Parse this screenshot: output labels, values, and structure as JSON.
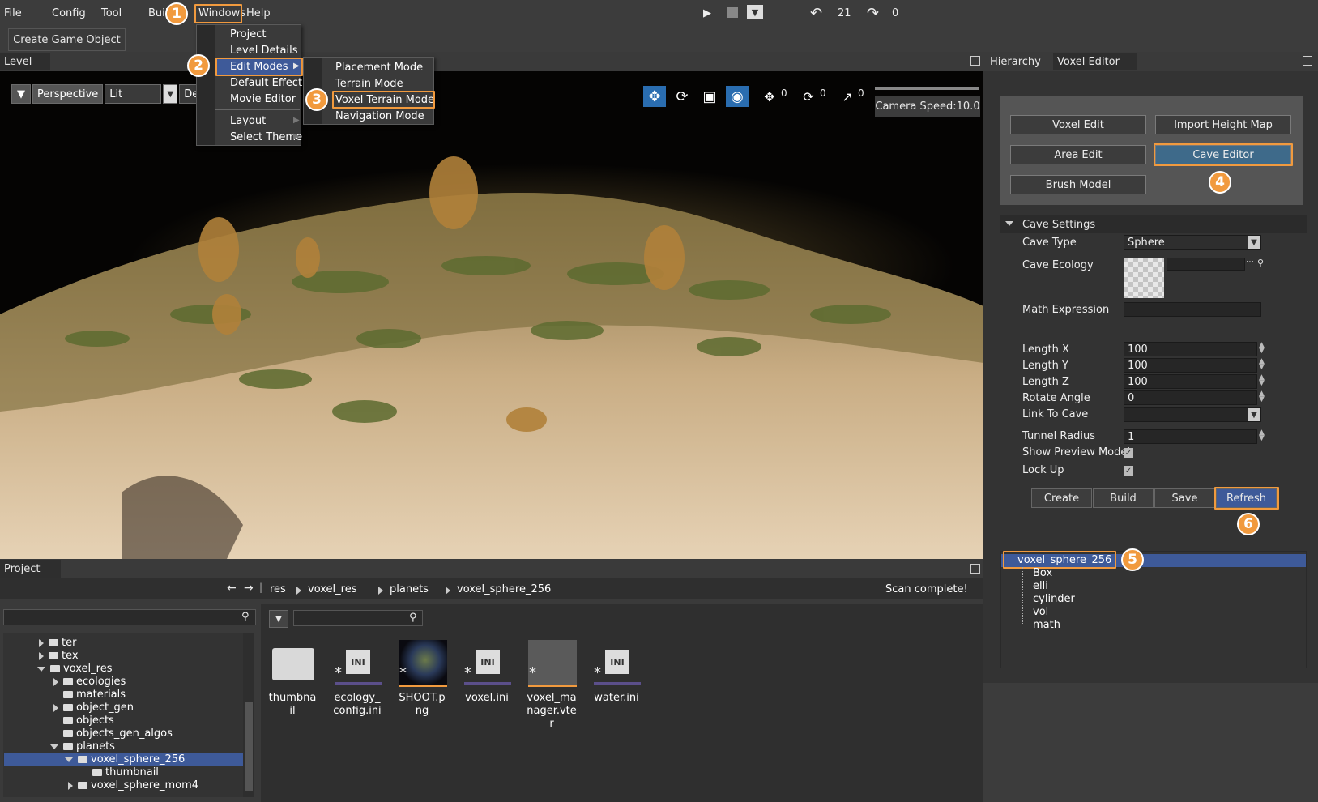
{
  "menu": [
    "File",
    "Config",
    "Tool",
    "Buil",
    "Windows",
    "Help"
  ],
  "toolbar": {
    "undo_count": "21",
    "redo_count": "0",
    "create_game_object": "Create Game Object"
  },
  "windows_menu": [
    "Project",
    "Level Details",
    "Edit Modes",
    "Default Effect",
    "Movie Editor",
    "Layout",
    "Select Theme"
  ],
  "edit_modes_menu": [
    "Placement Mode",
    "Terrain Mode",
    "Voxel Terrain Mode",
    "Navigation Mode"
  ],
  "viewport": {
    "tab": "Level",
    "perspective": "Perspective",
    "lit": "Lit",
    "default": "Defa",
    "move_count": "0",
    "rotate_count": "0",
    "scale_count": "0",
    "camera_speed": "Camera Speed:10.0"
  },
  "right_panel": {
    "tabs": [
      "Hierarchy",
      "Voxel Editor"
    ],
    "buttons": [
      "Voxel Edit",
      "Import Height Map",
      "Area Edit",
      "Cave Editor",
      "Brush Model"
    ],
    "section": "Cave Settings",
    "props": {
      "cave_type_label": "Cave Type",
      "cave_type": "Sphere",
      "cave_ecology_label": "Cave Ecology",
      "math_label": "Math Expression",
      "length_x_label": "Length X",
      "length_x": "100",
      "length_y_label": "Length Y",
      "length_y": "100",
      "length_z_label": "Length Z",
      "length_z": "100",
      "rotate_label": "Rotate Angle",
      "rotate": "0",
      "link_label": "Link To Cave",
      "tunnel_label": "Tunnel Radius",
      "tunnel": "1",
      "preview_label": "Show Preview Model",
      "lock_label": "Lock Up"
    },
    "actions": [
      "Create",
      "Build",
      "Save",
      "Refresh"
    ],
    "cave_tree": {
      "root": "voxel_sphere_256",
      "children": [
        "Box",
        "elli",
        "cylinder",
        "vol",
        "math"
      ]
    }
  },
  "project": {
    "tab": "Project",
    "breadcrumb": [
      "res",
      "voxel_res",
      "planets",
      "voxel_sphere_256"
    ],
    "status": "Scan complete!",
    "tree": [
      "ter",
      "tex",
      "voxel_res",
      "ecologies",
      "materials",
      "object_gen",
      "objects",
      "objects_gen_algos",
      "planets",
      "voxel_sphere_256",
      "thumbnail",
      "voxel_sphere_mom4"
    ],
    "files": [
      "thumbnail",
      "ecology_config.ini",
      "SHOOT.png",
      "voxel.ini",
      "voxel_manager.vter",
      "water.ini"
    ]
  },
  "badges": [
    "1",
    "2",
    "3",
    "4",
    "5",
    "6"
  ],
  "colors": {
    "highlight": "#f19a3e",
    "selection": "#3e5a99",
    "panel": "#3c3c3c"
  }
}
